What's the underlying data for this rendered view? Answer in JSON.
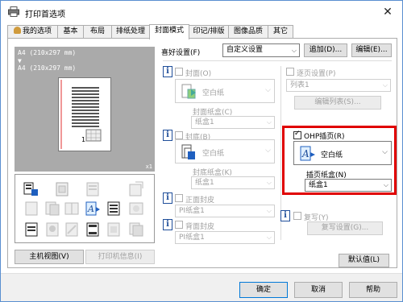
{
  "window": {
    "title": "打印首选项"
  },
  "tabs": [
    {
      "label": "我的选项"
    },
    {
      "label": "基本"
    },
    {
      "label": "布局"
    },
    {
      "label": "排纸处理"
    },
    {
      "label": "封面模式"
    },
    {
      "label": "印记/排版"
    },
    {
      "label": "图像品质"
    },
    {
      "label": "其它"
    }
  ],
  "preview": {
    "line1": "A4 (210x297 mm)",
    "arrow": "▼",
    "line2": "A4 (210x297 mm)",
    "page_num": "1",
    "copies": "x1"
  },
  "left_buttons": {
    "main_view": "主机视图(V)",
    "printer_info": "打印机信息(I)"
  },
  "favorites": {
    "label": "喜好设置(F)",
    "value": "自定义设置",
    "add": "追加(D)...",
    "edit": "编辑(E)..."
  },
  "front_cover": {
    "label": "封面(O)",
    "type_value": "空白纸",
    "tray_label": "封面纸盒(C)",
    "tray_value": "纸盒1"
  },
  "back_cover": {
    "label": "封底(B)",
    "type_value": "空白纸",
    "tray_label": "封底纸盒(K)",
    "tray_value": "纸盒1"
  },
  "front_insert": {
    "label": "正面封皮",
    "value": "PI纸盒1"
  },
  "back_insert": {
    "label": "背面封皮",
    "value": "PI纸盒1"
  },
  "page_setting": {
    "label": "逐页设置(P)",
    "list_value": "列表1",
    "edit_list": "编辑列表(S)..."
  },
  "ohp": {
    "label": "OHP插页(R)",
    "type_value": "空白纸",
    "tray_label": "插页纸盒(N)",
    "tray_value": "纸盒1"
  },
  "carbon": {
    "label": "复写(Y)",
    "settings": "复写设置(G)..."
  },
  "default_button": "默认值(L)",
  "footer": {
    "ok": "确定",
    "cancel": "取消",
    "help": "帮助"
  },
  "colors": {
    "highlight_border": "#e00000",
    "info_blue": "#1f4e9a"
  }
}
